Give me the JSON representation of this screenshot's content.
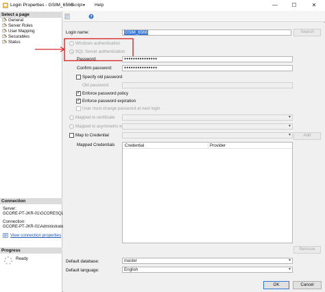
{
  "window": {
    "title": "Login Properties - GSIM_6566"
  },
  "left": {
    "select_page_header": "Select a page",
    "pages": [
      "General",
      "Server Roles",
      "User Mapping",
      "Securables",
      "Status"
    ],
    "connection_header": "Connection",
    "server_label": "Server:",
    "server_value": "GCORE-PT-JKR-01\\GCORESQL",
    "connection_label": "Connection:",
    "connection_value": "GCORE-PT-JKR-01\\Administrator",
    "view_connection_link": "View connection properties",
    "progress_header": "Progress",
    "progress_status": "Ready"
  },
  "toolbar": {
    "script_label": "Script",
    "help_label": "Help"
  },
  "form": {
    "login_name_label": "Login name:",
    "login_name_value": "GSIM_6566",
    "search_button": "Search",
    "windows_auth": "Windows authentication",
    "sql_auth": "SQL Server authentication",
    "password_label": "Password:",
    "password_value": "●●●●●●●●●●●●●●●",
    "confirm_password_label": "Confirm password:",
    "confirm_password_value": "●●●●●●●●●●●●●●●",
    "specify_old_password": "Specify old password",
    "old_password_label": "Old password:",
    "enforce_policy": "Enforce password policy",
    "enforce_expiration": "Enforce password expiration",
    "must_change": "User must change password at next login",
    "mapped_certificate": "Mapped to certificate",
    "mapped_asym_key": "Mapped to asymmetric key",
    "map_credential": "Map to Credential",
    "add_button": "Add",
    "mapped_credentials_label": "Mapped Credentials",
    "col_credential": "Credential",
    "col_provider": "Provider",
    "remove_button": "Remove",
    "default_db_label": "Default database:",
    "default_db_value": "master",
    "default_lang_label": "Default language:",
    "default_lang_value": "English"
  },
  "buttons": {
    "ok": "OK",
    "cancel": "Cancel"
  },
  "colors": {
    "highlight_box": "#d9262c",
    "selection": "#3375d6"
  }
}
